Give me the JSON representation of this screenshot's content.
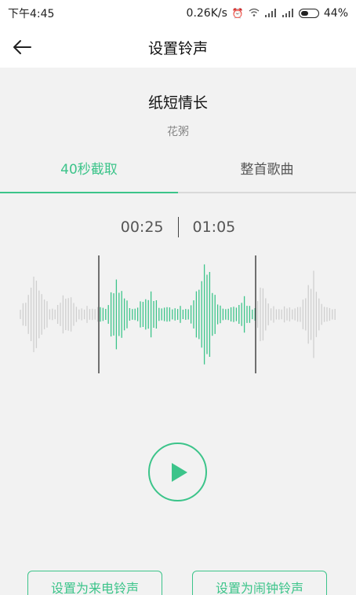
{
  "status_bar": {
    "time": "下午4:45",
    "network_speed": "0.26K/s",
    "battery_percent": "44%",
    "icons": [
      "alarm-icon",
      "wifi-icon",
      "signal-icon",
      "signal-icon",
      "battery-icon"
    ]
  },
  "header": {
    "title": "设置铃声",
    "back_icon": "arrow-left-icon"
  },
  "song": {
    "title": "纸短情长",
    "artist": "花粥"
  },
  "tabs": [
    {
      "label": "40秒截取",
      "active": true
    },
    {
      "label": "整首歌曲",
      "active": false
    }
  ],
  "selection": {
    "start": "00:25",
    "end": "01:05"
  },
  "buttons": {
    "set_call_ringtone": "设置为来电铃声",
    "set_alarm_ringtone": "设置为闹钟铃声"
  },
  "colors": {
    "accent": "#3cc48a",
    "waveform_inactive": "#cfcfcf"
  }
}
